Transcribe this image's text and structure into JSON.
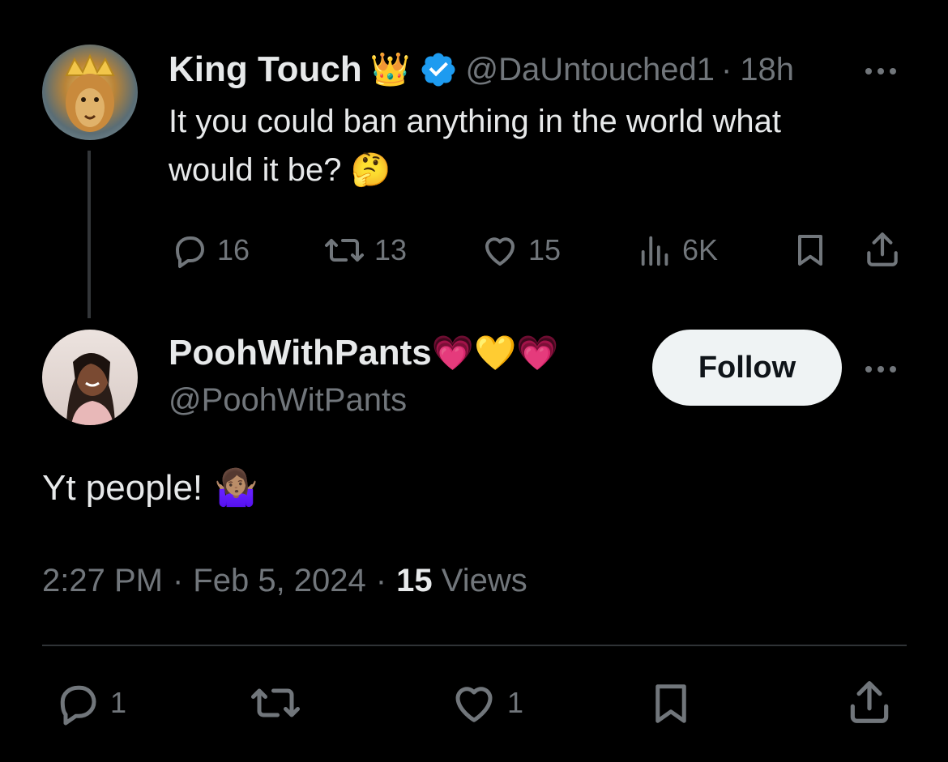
{
  "parent_tweet": {
    "author_name": "King Touch",
    "author_handle": "@DaUntouched1",
    "time_sep": "·",
    "time": "18h",
    "text_line1": "It you could ban anything in the world what",
    "text_line2": "would it be?",
    "text_emoji": "🤔",
    "name_emoji": "👑",
    "verified": true,
    "stats": {
      "replies": "16",
      "retweets": "13",
      "likes": "15",
      "views": "6K"
    }
  },
  "reply_tweet": {
    "author_name": "PoohWithPants",
    "name_emojis": [
      "💗",
      "💛",
      "💗"
    ],
    "author_handle": "@PoohWitPants",
    "follow_label": "Follow",
    "text": "Yt people!",
    "text_emoji": "🤷🏽‍♀️",
    "meta": {
      "time": "2:27 PM",
      "sep1": "·",
      "date": "Feb 5, 2024",
      "sep2": "·",
      "views_count": "15",
      "views_label": "Views"
    },
    "actions": {
      "replies": "1",
      "likes": "1"
    }
  },
  "colors": {
    "background": "#000000",
    "text_primary": "#e7e9ea",
    "text_secondary": "#71767b",
    "verified_blue": "#1d9bf0",
    "follow_bg": "#eff3f4",
    "divider": "#2f3336"
  }
}
